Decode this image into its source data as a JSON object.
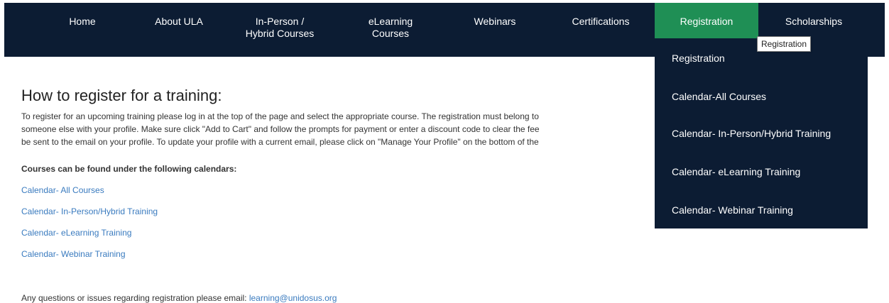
{
  "nav": {
    "home": "Home",
    "about": "About ULA",
    "in_person_line1": "In-Person /",
    "in_person_line2": "Hybrid Courses",
    "elearning_line1": "eLearning",
    "elearning_line2": "Courses",
    "webinars": "Webinars",
    "certifications": "Certifications",
    "registration": "Registration",
    "scholarships": "Scholarships"
  },
  "tooltip": "Registration",
  "dropdown": {
    "items": [
      "Registration",
      "Calendar-All Courses",
      "Calendar- In-Person/Hybrid Training",
      "Calendar- eLearning Training",
      "Calendar- Webinar Training"
    ]
  },
  "content": {
    "heading": "How to register for a training:",
    "intro_lines": [
      "To register for an upcoming training please log in at the top of the page and select the appropriate course. The registration must belong to",
      "someone else with your profile. Make sure click \"Add to Cart\" and follow the prompts for payment or enter a discount code to clear the fee",
      "be sent to the email on your profile. To update your profile with a current email, please click on \"Manage Your Profile\" on the bottom of the"
    ],
    "subheading": "Courses can be found under the following calendars:",
    "calendar_links": [
      "Calendar- All Courses",
      "Calendar- In-Person/Hybrid Training",
      "Calendar- eLearning Training",
      "Calendar- Webinar Training"
    ],
    "footer_text": "Any questions or issues regarding registration please email: ",
    "footer_email": "learning@unidosus.org"
  },
  "colors": {
    "nav_bg": "#0c1c33",
    "active_bg": "#1f8f55",
    "link": "#3a7bbf"
  }
}
